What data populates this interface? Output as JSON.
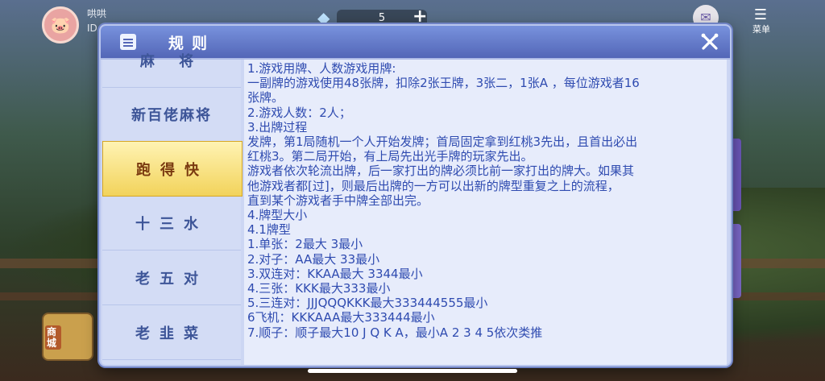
{
  "background": {
    "player_name": "哄哄",
    "player_id_prefix": "ID",
    "diamond_count": "5",
    "plus_label": "+",
    "menu_label": "菜单",
    "shop_label": "商城"
  },
  "dialog": {
    "title": "规则",
    "sidebar": [
      {
        "label": "麻 将",
        "active": false
      },
      {
        "label": "新百佬麻将",
        "active": false
      },
      {
        "label": "跑得快",
        "active": true
      },
      {
        "label": "十三水",
        "active": false
      },
      {
        "label": "老五对",
        "active": false
      },
      {
        "label": "老韭菜",
        "active": false
      }
    ],
    "content_lines": [
      "1.游戏用牌、人数游戏用牌:",
      "一副牌的游戏使用48张牌，扣除2张王牌，3张二，1张A ，每位游戏者16",
      "张牌。",
      "2.游戏人数：2人；",
      "3.出牌过程",
      "发牌，第1局随机一个人开始发牌；首局固定拿到红桃3先出，且首出必出",
      "红桃3。第二局开始，有上局先出光手牌的玩家先出。",
      "游戏者依次轮流出牌，后一家打出的牌必须比前一家打出的牌大。如果其",
      "他游戏者都[过]，则最后出牌的一方可以出新的牌型重复之上的流程，",
      "直到某个游戏者手中牌全部出完。",
      "4.牌型大小",
      "4.1牌型",
      "1.单张：2最大 3最小",
      "2.对子：AA最大 33最小",
      "3.双连对：KKAA最大 3344最小",
      "4.三张：KKK最大333最小",
      "5.三连对：JJJQQQKKK最大333444555最小",
      "6飞机：KKKAAA最大333444最小",
      "7.顺子：顺子最大10 J Q K A，最小A 2 3 4 5依次类推"
    ]
  },
  "colors": {
    "header": "#5a6fc0",
    "active_tab": "#f2d35b",
    "content_text": "#2f4bb0",
    "sidebar_text": "#3d5598"
  }
}
